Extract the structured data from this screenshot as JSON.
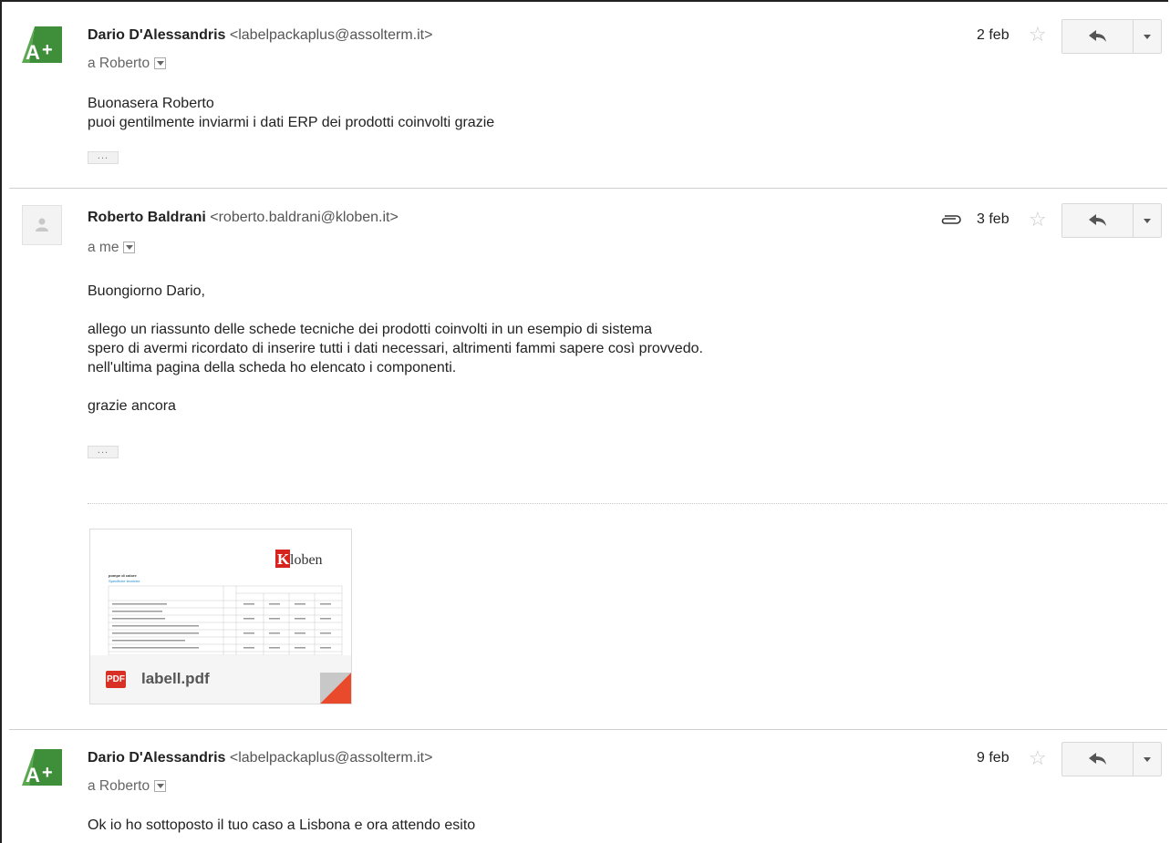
{
  "messages": [
    {
      "sender_name": "Dario D'Alessandris",
      "sender_email": "<labelpackaplus@assolterm.it>",
      "to": "a Roberto",
      "date": "2 feb",
      "body_lines": [
        "Buonasera Roberto",
        "puoi gentilmente inviarmi i dati ERP dei prodotti coinvolti grazie"
      ],
      "ellipsis": "..."
    },
    {
      "sender_name": "Roberto Baldrani",
      "sender_email": "<roberto.baldrani@kloben.it>",
      "to": "a me",
      "date": "3 feb",
      "body_lines": [
        "Buongiorno Dario,",
        "allego un riassunto delle schede tecniche dei prodotti coinvolti in un esempio di sistema",
        "spero di avermi ricordato di inserire tutti i dati necessari, altrimenti fammi sapere così provvedo.",
        "nell'ultima pagina della scheda ho elencato i componenti.",
        "grazie ancora"
      ],
      "ellipsis": "...",
      "attachment": {
        "icon_label": "PDF",
        "file_name": "labell.pdf",
        "thumb_logo": "Kloben",
        "thumb_title": "pompe di calore",
        "thumb_subtitle": "Specifiche tecniche"
      }
    },
    {
      "sender_name": "Dario D'Alessandris",
      "sender_email": "<labelpackaplus@assolterm.it>",
      "to": "a Roberto",
      "date": "9 feb",
      "body_lines": [
        "Ok io ho sottoposto il tuo caso a Lisbona e ora attendo esito"
      ]
    }
  ],
  "colors": {
    "avatar_green": "#3f8f3a",
    "pdf_red": "#d93025",
    "fold_red": "#e84a2b",
    "kloben_red": "#d6231e"
  },
  "icons": {
    "star": "star-icon",
    "reply": "reply-icon",
    "more": "chevron-down-icon",
    "attachment": "paperclip-icon"
  }
}
